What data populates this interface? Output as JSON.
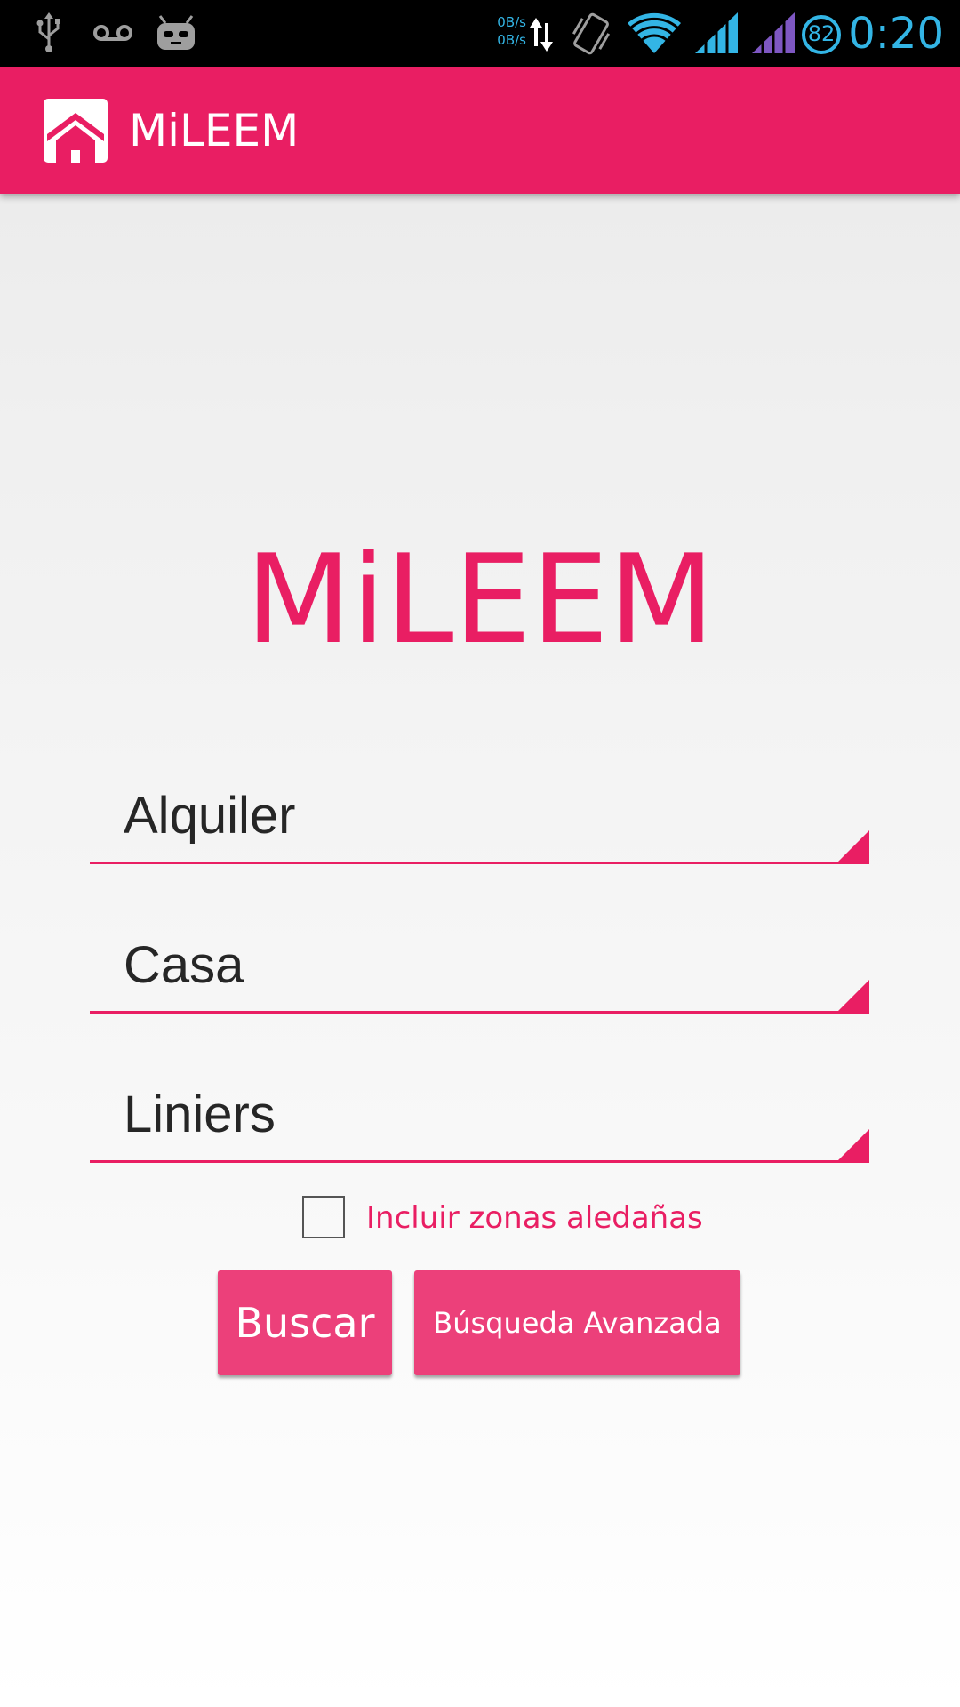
{
  "status_bar": {
    "net_up": "0B/s",
    "net_down": "0B/s",
    "battery": "82",
    "time": "0:20",
    "icons": [
      "usb-icon",
      "voicemail-icon",
      "cyanogen-android-icon",
      "data-transfer-icon",
      "vibrate-icon",
      "wifi-icon",
      "signal-icon",
      "signal-icon-2",
      "battery-icon"
    ]
  },
  "action_bar": {
    "title": "MiLEEM",
    "icon": "house-icon"
  },
  "main": {
    "title": "MiLEEM",
    "spinners": [
      {
        "value": "Alquiler"
      },
      {
        "value": "Casa"
      },
      {
        "value": "Liniers"
      }
    ],
    "checkbox": {
      "label": "Incluir zonas aledañas",
      "checked": false
    },
    "buttons": {
      "search": "Buscar",
      "advanced": "Búsqueda Avanzada"
    }
  },
  "colors": {
    "primary": "#e91e63",
    "button": "#ec407a",
    "status_accent": "#33b5e5"
  }
}
